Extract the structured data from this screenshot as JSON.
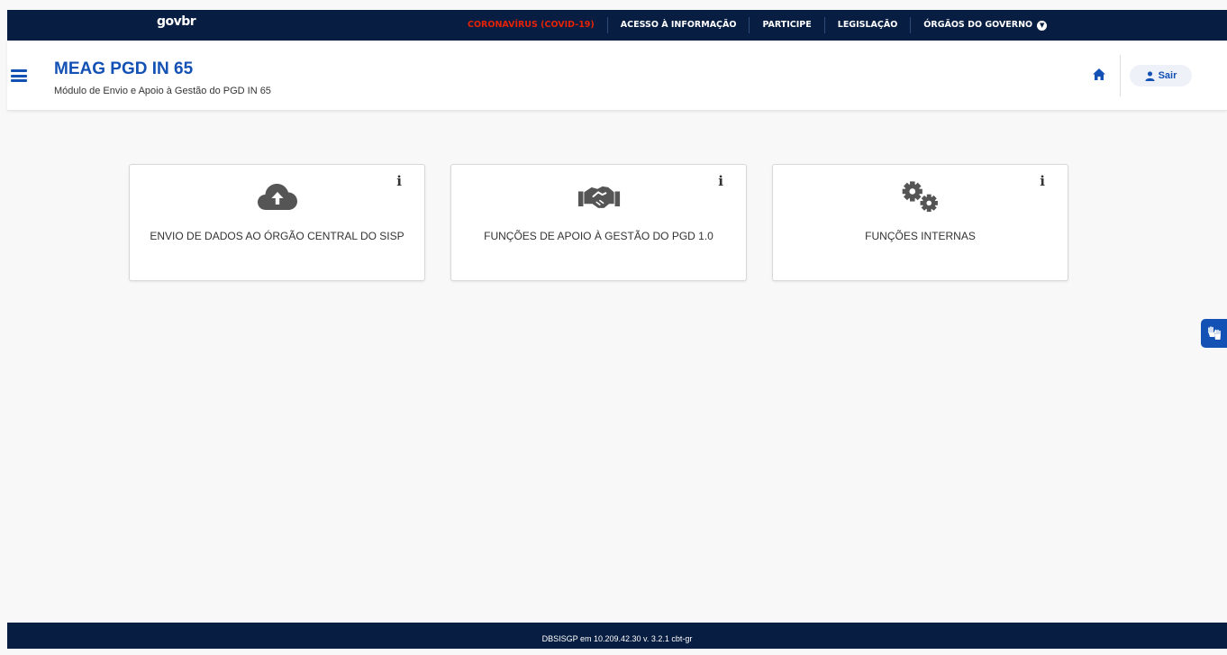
{
  "govbar": {
    "logo": "govbr",
    "links": [
      "CORONAVÍRUS (COVID-19)",
      "ACESSO À INFORMAÇÃO",
      "PARTICIPE",
      "LEGISLAÇÃO",
      "ÓRGÃOS DO GOVERNO"
    ],
    "dropdown_icon": "chevron-down-icon"
  },
  "header": {
    "menu_icon": "hamburger-menu-icon",
    "title": "MEAG PGD IN 65",
    "subtitle": "Módulo de Envio e Apoio à Gestão do PGD IN 65",
    "home_icon": "home-icon",
    "logout_label": "Sair",
    "user_icon": "user-icon"
  },
  "cards": [
    {
      "icon": "cloud-upload-icon",
      "info": "i",
      "label": "ENVIO DE DADOS AO ÓRGÃO CENTRAL DO SISP"
    },
    {
      "icon": "handshake-icon",
      "info": "i",
      "label": "FUNÇÕES DE APOIO À GESTÃO DO PGD 1.0"
    },
    {
      "icon": "gears-icon",
      "info": "i",
      "label": "FUNÇÕES INTERNAS"
    }
  ],
  "vlibras_icon": "sign-language-hands-icon",
  "footer": {
    "text": "DBSISGP em 10.209.42.30 v. 3.2.1 cbt-gr"
  },
  "colors": {
    "govbar_bg": "#071d41",
    "primary": "#1351b4",
    "covid": "#e52207",
    "icon_gray": "#555555"
  }
}
